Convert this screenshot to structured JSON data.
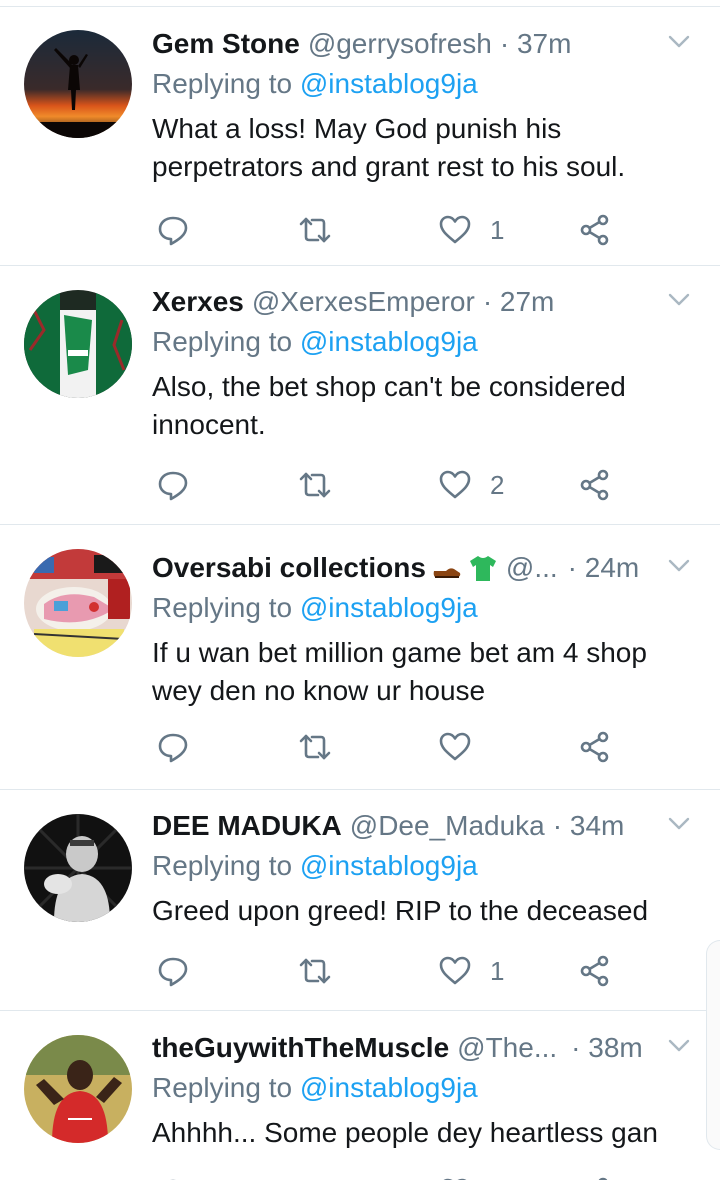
{
  "tweets": [
    {
      "name": "Gem Stone",
      "handle": "@gerrysofresh",
      "time": "· 37m",
      "replying_prefix": "Replying to ",
      "replying_handle": "@instablog9ja",
      "text": "What a loss! May God punish his perpetrators and grant rest to his soul.",
      "like_count": "1"
    },
    {
      "name": "Xerxes",
      "handle": "@XerxesEmperor",
      "time": "· 27m",
      "replying_prefix": "Replying to ",
      "replying_handle": "@instablog9ja",
      "text": "Also, the bet shop can't be considered innocent.",
      "like_count": "2"
    },
    {
      "name": "Oversabi collections",
      "handle": "@...",
      "time": "· 24m",
      "name_emojis": [
        "shoe-emoji",
        "tshirt-emoji"
      ],
      "replying_prefix": "Replying to ",
      "replying_handle": "@instablog9ja",
      "text": "If u wan bet million game bet am 4 shop wey den no know ur house",
      "like_count": ""
    },
    {
      "name": "DEE MADUKA",
      "handle": "@Dee_Maduka",
      "time": "· 34m",
      "replying_prefix": "Replying to ",
      "replying_handle": "@instablog9ja",
      "text": "Greed upon greed! RIP to the deceased",
      "like_count": "1"
    },
    {
      "name": "theGuywithTheMuscle",
      "handle": "@The...",
      "time": "· 38m",
      "replying_prefix": "Replying to ",
      "replying_handle": "@instablog9ja",
      "text": "Ahhhh... Some people dey heartless gan",
      "like_count": ""
    }
  ],
  "colors": {
    "name": "#14171a",
    "secondary": "#657786",
    "mention": "#1da1f2",
    "icon": "#657786",
    "divider": "#e1e8ed"
  },
  "icons": {
    "reply": "reply-icon",
    "retweet": "retweet-icon",
    "like": "heart-icon",
    "share": "share-icon",
    "caret": "chevron-down-icon"
  }
}
